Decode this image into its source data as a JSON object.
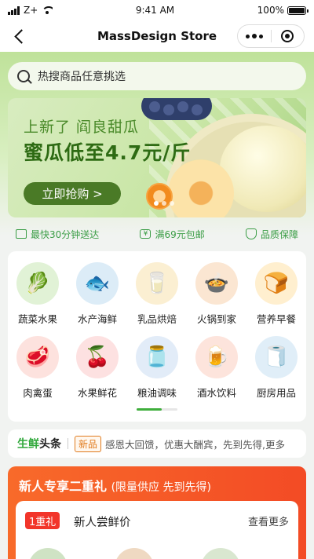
{
  "status_bar": {
    "carrier": "Z+",
    "time": "9:41 AM",
    "battery": "100%"
  },
  "nav": {
    "title": "MassDesign Store"
  },
  "search": {
    "placeholder": "热搜商品任意挑选"
  },
  "banner": {
    "subtitle": "上新了 阎良甜瓜",
    "title": "蜜瓜低至4.7元/斤",
    "button": "立即抢购 >"
  },
  "features": [
    {
      "icon": "delivery-icon",
      "label": "最快30分钟送达"
    },
    {
      "icon": "coupon-icon",
      "label": "满69元包邮"
    },
    {
      "icon": "shield-icon",
      "label": "品质保障"
    }
  ],
  "categories": [
    {
      "label": "蔬菜水果",
      "icon": "vegetables-icon",
      "glyph": "🥬"
    },
    {
      "label": "水产海鲜",
      "icon": "seafood-icon",
      "glyph": "🐟"
    },
    {
      "label": "乳品烘焙",
      "icon": "dairy-icon",
      "glyph": "🥛"
    },
    {
      "label": "火锅到家",
      "icon": "hotpot-icon",
      "glyph": "🍲"
    },
    {
      "label": "营养早餐",
      "icon": "breakfast-icon",
      "glyph": "🍞"
    },
    {
      "label": "肉禽蛋",
      "icon": "meat-icon",
      "glyph": "🥩"
    },
    {
      "label": "水果鲜花",
      "icon": "fruit-icon",
      "glyph": "🍒"
    },
    {
      "label": "粮油调味",
      "icon": "oil-icon",
      "glyph": "🫙"
    },
    {
      "label": "酒水饮料",
      "icon": "drinks-icon",
      "glyph": "🍺"
    },
    {
      "label": "厨房用品",
      "icon": "kitchen-icon",
      "glyph": "🧻"
    }
  ],
  "headline": {
    "brand_a": "生鲜",
    "brand_b": "头条",
    "tag": "新品",
    "text": "感恩大回馈，优惠大酬宾，先到先得,更多"
  },
  "promo": {
    "title": "新人专享二重礼",
    "subtitle": "(限量供应 先到先得)",
    "badge": "1重礼",
    "item_title": "新人尝鲜价",
    "more": "查看更多"
  },
  "colors": {
    "accent_green": "#3fae3c",
    "promo_orange": "#f86a2a",
    "badge_red": "#f2352a"
  }
}
